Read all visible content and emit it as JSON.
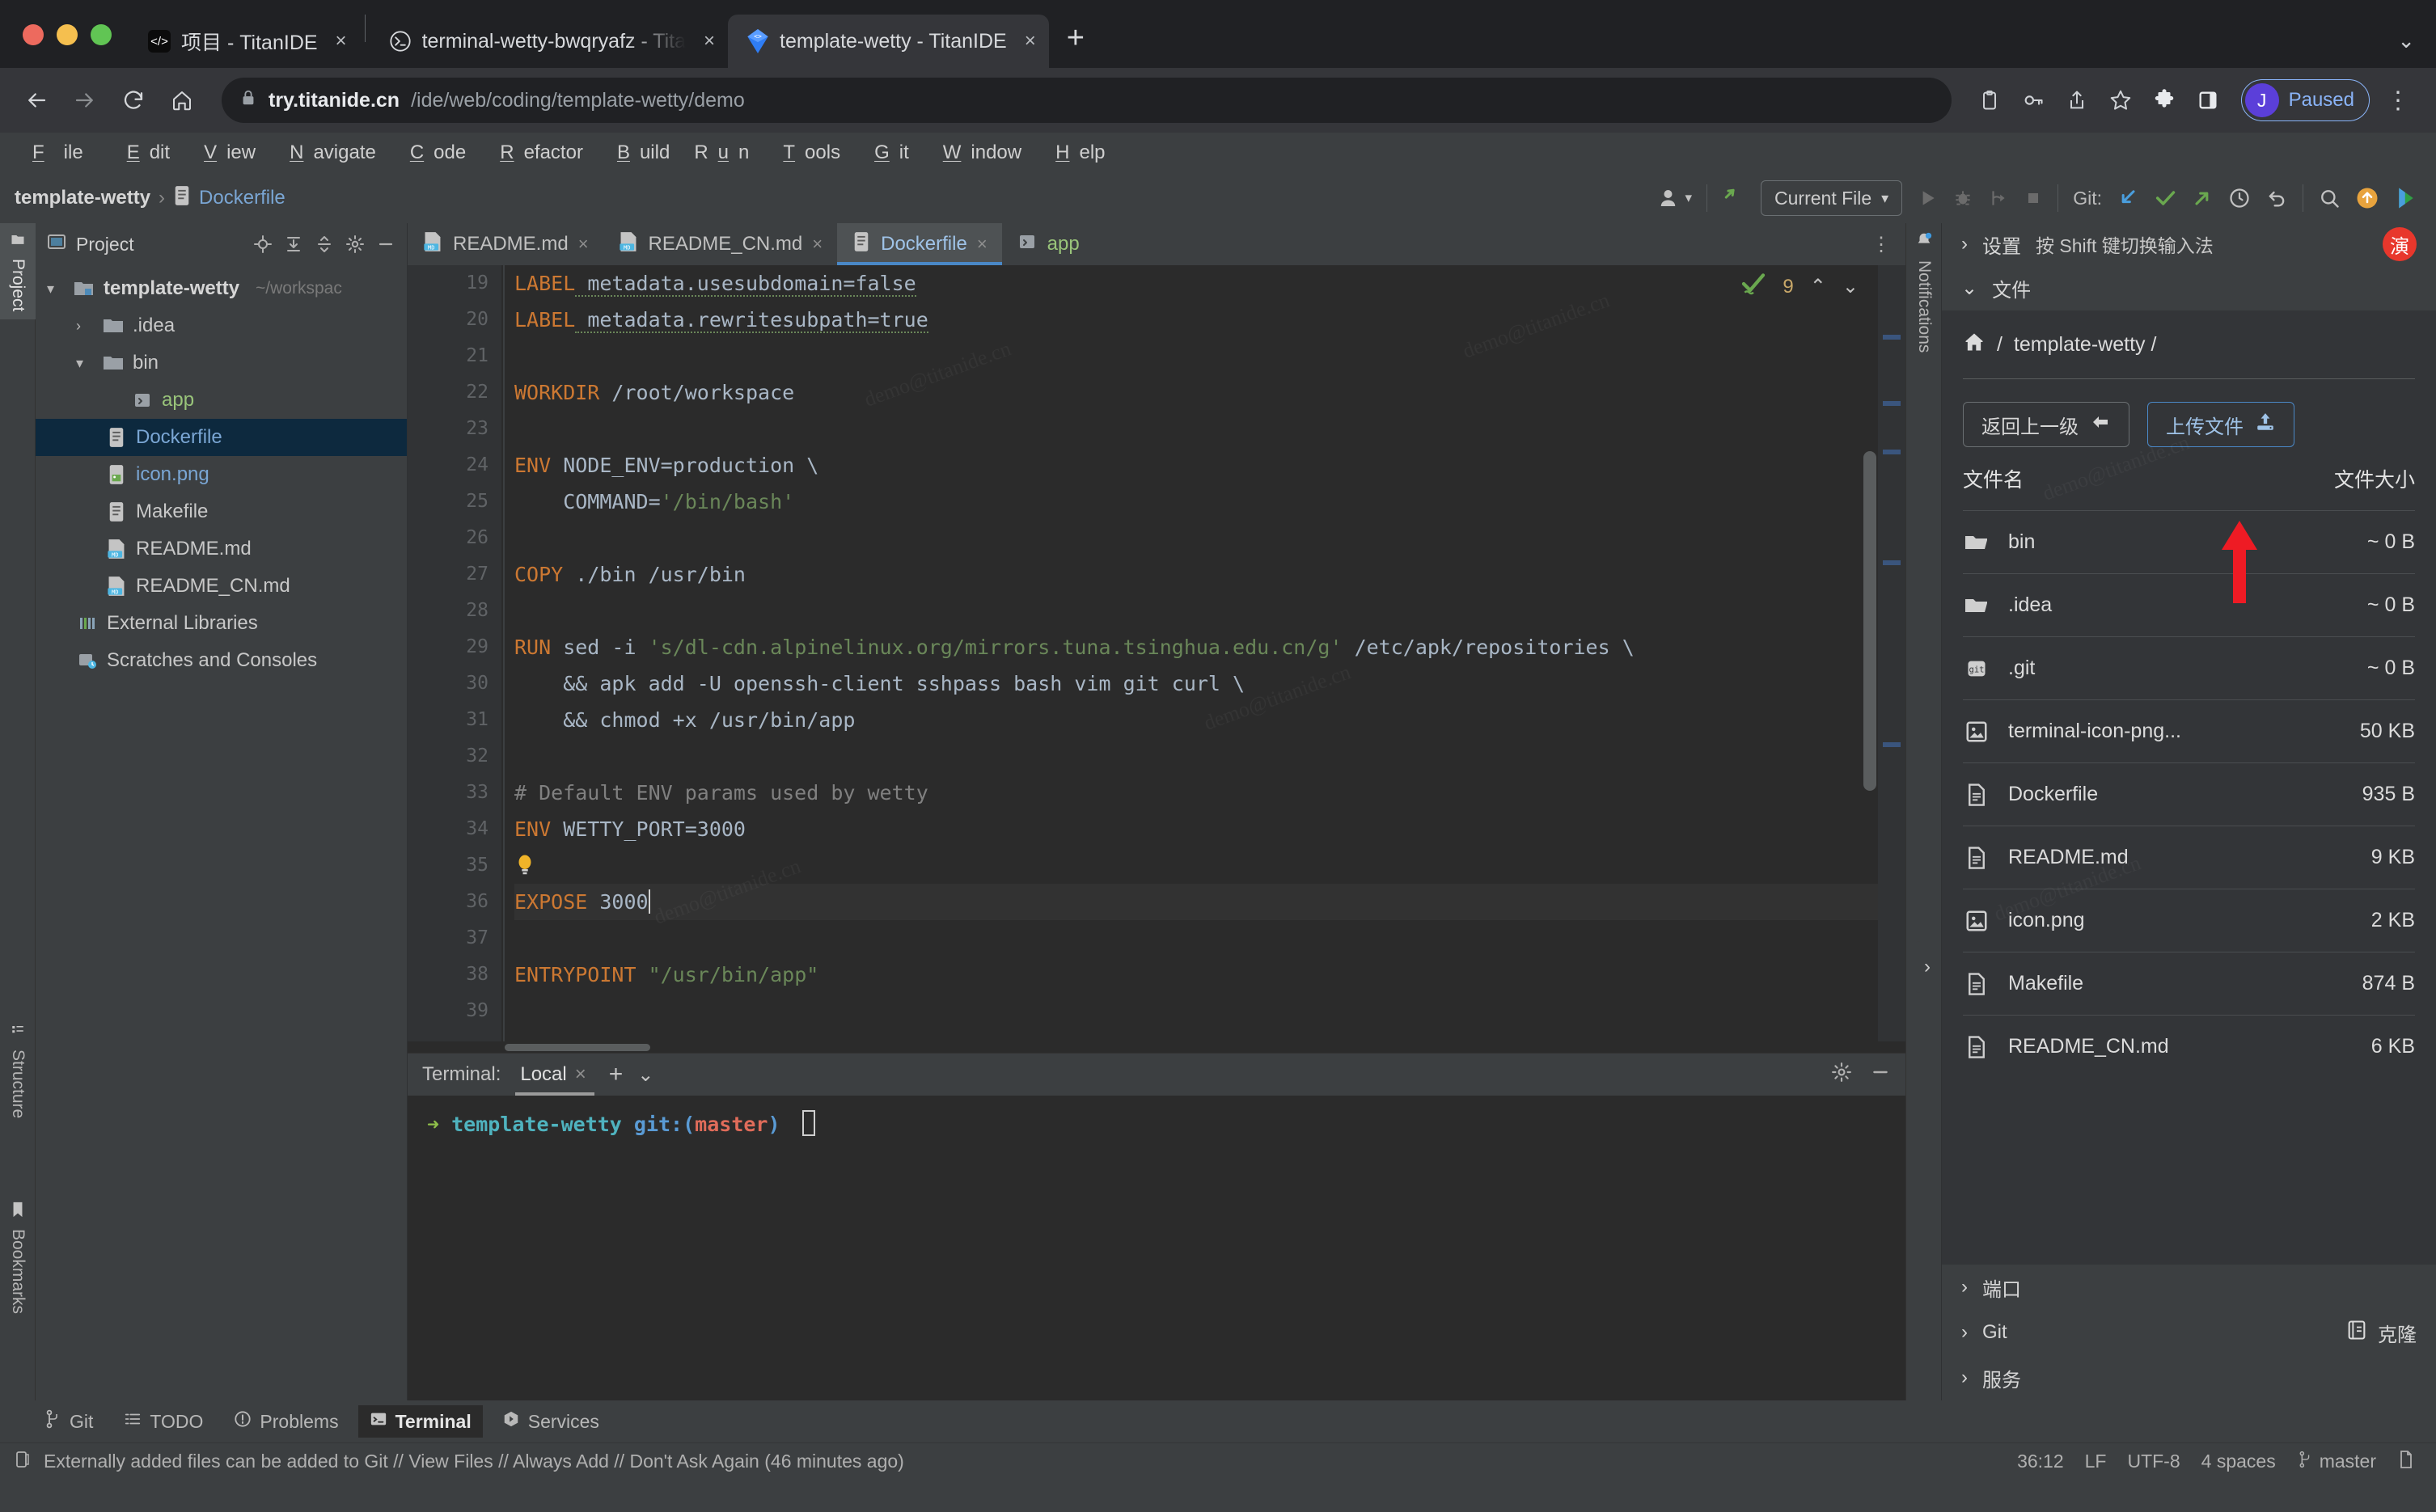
{
  "browser": {
    "tabs": [
      {
        "title": "项目 - TitanIDE",
        "icon": "titanide-icon",
        "active": false
      },
      {
        "title": "terminal-wetty-bwqryafz - Tita",
        "icon": "terminal-icon",
        "active": false
      },
      {
        "title": "template-wetty - TitanIDE",
        "icon": "titanide-diamond-icon",
        "active": true
      }
    ],
    "close_label": "×",
    "newtab_label": "+",
    "url_strong": "try.titanide.cn",
    "url_dim": "/ide/web/coding/template-wetty/demo",
    "profile_initial": "J",
    "profile_label": "Paused"
  },
  "ide": {
    "menu": [
      "File",
      "Edit",
      "View",
      "Navigate",
      "Code",
      "Refactor",
      "Build",
      "Run",
      "Tools",
      "Git",
      "Window",
      "Help"
    ],
    "breadcrumb": {
      "project": "template-wetty",
      "file": "Dockerfile"
    },
    "toolbar": {
      "run_config": "Current File",
      "git_label": "Git:"
    },
    "left_rail": [
      "Project",
      "Structure",
      "Bookmarks"
    ],
    "right_rail": "Notifications",
    "project_panel": {
      "title": "Project",
      "tree": [
        {
          "label": "template-wetty",
          "sub": "~/workspac",
          "arrow": "▾",
          "icon": "module-icon",
          "depth": 0,
          "selected": false,
          "color": "#c8c8c8",
          "bold": true
        },
        {
          "label": ".idea",
          "sub": "",
          "arrow": "›",
          "icon": "folder-icon",
          "depth": 1,
          "selected": false,
          "color": "#c8c8c8",
          "bold": false
        },
        {
          "label": "bin",
          "sub": "",
          "arrow": "▾",
          "icon": "folder-icon",
          "depth": 1,
          "selected": false,
          "color": "#c8c8c8",
          "bold": false
        },
        {
          "label": "app",
          "sub": "",
          "arrow": "",
          "icon": "script-icon",
          "depth": 2,
          "selected": false,
          "color": "#99c47a",
          "bold": false
        },
        {
          "label": "Dockerfile",
          "sub": "",
          "arrow": "",
          "icon": "file-icon",
          "depth": 2,
          "selected": true,
          "color": "#7aa6d4",
          "bold": false
        },
        {
          "label": "icon.png",
          "sub": "",
          "arrow": "",
          "icon": "image-icon",
          "depth": 2,
          "selected": false,
          "color": "#7aa6d4",
          "bold": false
        },
        {
          "label": "Makefile",
          "sub": "",
          "arrow": "",
          "icon": "file-icon",
          "depth": 2,
          "selected": false,
          "color": "#c8c8c8",
          "bold": false
        },
        {
          "label": "README.md",
          "sub": "",
          "arrow": "",
          "icon": "md-icon",
          "depth": 2,
          "selected": false,
          "color": "#c8c8c8",
          "bold": false
        },
        {
          "label": "README_CN.md",
          "sub": "",
          "arrow": "",
          "icon": "md-icon",
          "depth": 2,
          "selected": false,
          "color": "#c8c8c8",
          "bold": false
        },
        {
          "label": "External Libraries",
          "sub": "",
          "arrow": "",
          "icon": "library-icon",
          "depth": 1,
          "selected": false,
          "color": "#c8c8c8",
          "bold": false
        },
        {
          "label": "Scratches and Consoles",
          "sub": "",
          "arrow": "",
          "icon": "scratch-icon",
          "depth": 1,
          "selected": false,
          "color": "#c8c8c8",
          "bold": false
        }
      ]
    },
    "editor": {
      "tabs": [
        {
          "label": "README.md",
          "icon": "md-icon",
          "active": false,
          "closeable": true,
          "green": false
        },
        {
          "label": "README_CN.md",
          "icon": "md-icon",
          "active": false,
          "closeable": true,
          "green": false
        },
        {
          "label": "Dockerfile",
          "icon": "file-icon",
          "active": true,
          "closeable": true,
          "green": false
        },
        {
          "label": "app",
          "icon": "script-icon",
          "active": false,
          "closeable": false,
          "green": true
        }
      ],
      "inspection_count": "9",
      "first_line": 19,
      "lines": [
        {
          "n": 19,
          "segments": [
            {
              "t": "LABEL",
              "c": "k"
            },
            {
              "t": " metadata.usesubdomain=false",
              "c": "sq"
            }
          ]
        },
        {
          "n": 20,
          "segments": [
            {
              "t": "LABEL",
              "c": "k"
            },
            {
              "t": " metadata.rewritesubpath=true",
              "c": "sq"
            }
          ]
        },
        {
          "n": 21,
          "segments": []
        },
        {
          "n": 22,
          "segments": [
            {
              "t": "WORKDIR",
              "c": "k"
            },
            {
              "t": " /root/workspace",
              "c": ""
            }
          ]
        },
        {
          "n": 23,
          "segments": []
        },
        {
          "n": 24,
          "segments": [
            {
              "t": "ENV",
              "c": "k"
            },
            {
              "t": " NODE_ENV=production \\",
              "c": ""
            }
          ]
        },
        {
          "n": 25,
          "segments": [
            {
              "t": "    COMMAND=",
              "c": ""
            },
            {
              "t": "'/bin/bash'",
              "c": "s"
            }
          ]
        },
        {
          "n": 26,
          "segments": []
        },
        {
          "n": 27,
          "segments": [
            {
              "t": "COPY",
              "c": "k"
            },
            {
              "t": " ./bin /usr/bin",
              "c": ""
            }
          ]
        },
        {
          "n": 28,
          "segments": []
        },
        {
          "n": 29,
          "segments": [
            {
              "t": "RUN",
              "c": "k"
            },
            {
              "t": " sed -i ",
              "c": ""
            },
            {
              "t": "'s/dl-cdn.alpinelinux.org/mirrors.tuna.tsinghua.edu.cn/g'",
              "c": "s"
            },
            {
              "t": " /etc/apk/repositories \\",
              "c": ""
            }
          ]
        },
        {
          "n": 30,
          "segments": [
            {
              "t": "    && apk add -U openssh-client sshpass bash vim git curl \\",
              "c": ""
            }
          ]
        },
        {
          "n": 31,
          "segments": [
            {
              "t": "    && chmod +x /usr/bin/app",
              "c": ""
            }
          ]
        },
        {
          "n": 32,
          "segments": []
        },
        {
          "n": 33,
          "segments": [
            {
              "t": "# Default ENV params used by wetty",
              "c": "cm"
            }
          ]
        },
        {
          "n": 34,
          "segments": [
            {
              "t": "ENV",
              "c": "k"
            },
            {
              "t": " WETTY_PORT=3000",
              "c": ""
            }
          ]
        },
        {
          "n": 35,
          "segments": [
            {
              "t": "  ",
              "c": "lb"
            }
          ]
        },
        {
          "n": 36,
          "segments": [
            {
              "t": "EXPOSE",
              "c": "k"
            },
            {
              "t": " 3000",
              "c": ""
            }
          ],
          "highlight": true,
          "caret": true
        },
        {
          "n": 37,
          "segments": []
        },
        {
          "n": 38,
          "segments": [
            {
              "t": "ENTRYPOINT",
              "c": "k"
            },
            {
              "t": " ",
              "c": ""
            },
            {
              "t": "\"/usr/bin/app\"",
              "c": "s"
            }
          ]
        },
        {
          "n": 39,
          "segments": []
        }
      ]
    },
    "terminal": {
      "label": "Terminal:",
      "tab": "Local",
      "close": "×",
      "add": "+",
      "chevron": "⌄",
      "prompt_arrow": "➜",
      "prompt_dir": "template-wetty",
      "prompt_git": "git:(",
      "prompt_branch": "master",
      "prompt_git_close": ")"
    },
    "status_tools": [
      {
        "label": "Git",
        "icon": "git-branch-icon",
        "active": false
      },
      {
        "label": "TODO",
        "icon": "todo-icon",
        "active": false
      },
      {
        "label": "Problems",
        "icon": "problems-icon",
        "active": false
      },
      {
        "label": "Terminal",
        "icon": "terminal-icon",
        "active": true
      },
      {
        "label": "Services",
        "icon": "services-icon",
        "active": false
      }
    ],
    "statusbar": {
      "message": "Externally added files can be added to Git // View Files // Always Add // Don't Ask Again (46 minutes ago)",
      "position": "36:12",
      "line_sep": "LF",
      "encoding": "UTF-8",
      "indent": "4 spaces",
      "branch": "master"
    }
  },
  "right_panel": {
    "settings_label": "设置",
    "ime_hint": "按 Shift 键切换输入法",
    "ime_badge": "演",
    "files_section": "文件",
    "breadcrumb_home": "⌂",
    "breadcrumb_sep": "/",
    "breadcrumb_path": "template-wetty /",
    "back_button": "返回上一级",
    "upload_button": "上传文件",
    "col_name": "文件名",
    "col_size": "文件大小",
    "rows": [
      {
        "name": "bin",
        "size": "~ 0 B",
        "icon": "folder-icon"
      },
      {
        "name": ".idea",
        "size": "~ 0 B",
        "icon": "folder-icon"
      },
      {
        "name": ".git",
        "size": "~ 0 B",
        "icon": "git-icon"
      },
      {
        "name": "terminal-icon-png...",
        "size": "50 KB",
        "icon": "image-icon"
      },
      {
        "name": "Dockerfile",
        "size": "935 B",
        "icon": "file-icon"
      },
      {
        "name": "README.md",
        "size": "9 KB",
        "icon": "file-icon"
      },
      {
        "name": "icon.png",
        "size": "2 KB",
        "icon": "image-icon"
      },
      {
        "name": "Makefile",
        "size": "874 B",
        "icon": "file-icon"
      },
      {
        "name": "README_CN.md",
        "size": "6 KB",
        "icon": "file-icon"
      }
    ],
    "bottom_sections": [
      {
        "label": "端口",
        "action": ""
      },
      {
        "label": "Git",
        "action": "克隆"
      },
      {
        "label": "服务",
        "action": ""
      }
    ]
  },
  "watermark": "demo@titanide.cn"
}
